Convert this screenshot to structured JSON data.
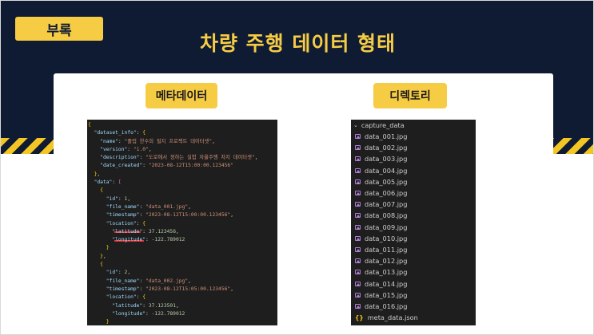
{
  "header": {
    "badge": "부록",
    "title": "차량 주행 데이터 형태"
  },
  "labels": {
    "metadata": "메타데이터",
    "directory": "디렉토리"
  },
  "code_lines": [
    "{",
    "  \"dataset_info\": {",
    "    \"name\": \"졸업 한수희 필지 프로젝트 데이터셋\",",
    "    \"version\": \"1.0\",",
    "    \"description\": \"도로에서 정하는 실험 자율주행 차지 데이터셋\",",
    "    \"date_created\": \"2023-08-12T15:00:00.123456\"",
    "  },",
    "  \"data\": [",
    "    {",
    "      \"id\": 1,",
    "      \"file_name\": \"data_001.jpg\",",
    "      \"timestamp\": \"2023-08-12T15:00:00.123456\",",
    "      \"location\": {",
    "        \"latitude\": 37.123456,",
    "        \"longitude\": -122.789012",
    "      }",
    "    },",
    "    {",
    "      \"id\": 2,",
    "      \"file_name\": \"data_002.jpg\",",
    "      \"timestamp\": \"2023-08-12T15:05:00.123456\",",
    "      \"location\": {",
    "        \"latitude\": 37.123501,",
    "        \"longitude\": -122.789012",
    "      }",
    "    },"
  ],
  "tree": {
    "folder": "capture_data",
    "files": [
      "data_001.jpg",
      "data_002.jpg",
      "data_003.jpg",
      "data_004.jpg",
      "data_005.jpg",
      "data_006.jpg",
      "data_007.jpg",
      "data_008.jpg",
      "data_009.jpg",
      "data_010.jpg",
      "data_011.jpg",
      "data_012.jpg",
      "data_013.jpg",
      "data_014.jpg",
      "data_015.jpg",
      "data_016.jpg"
    ],
    "json_file": "meta_data.json",
    "json_icon": "{}"
  },
  "colors": {
    "navy": "#0e1b33",
    "accent_yellow": "#f7cc45",
    "code_bg": "#1e1e1e",
    "underline_red": "#e03030"
  }
}
